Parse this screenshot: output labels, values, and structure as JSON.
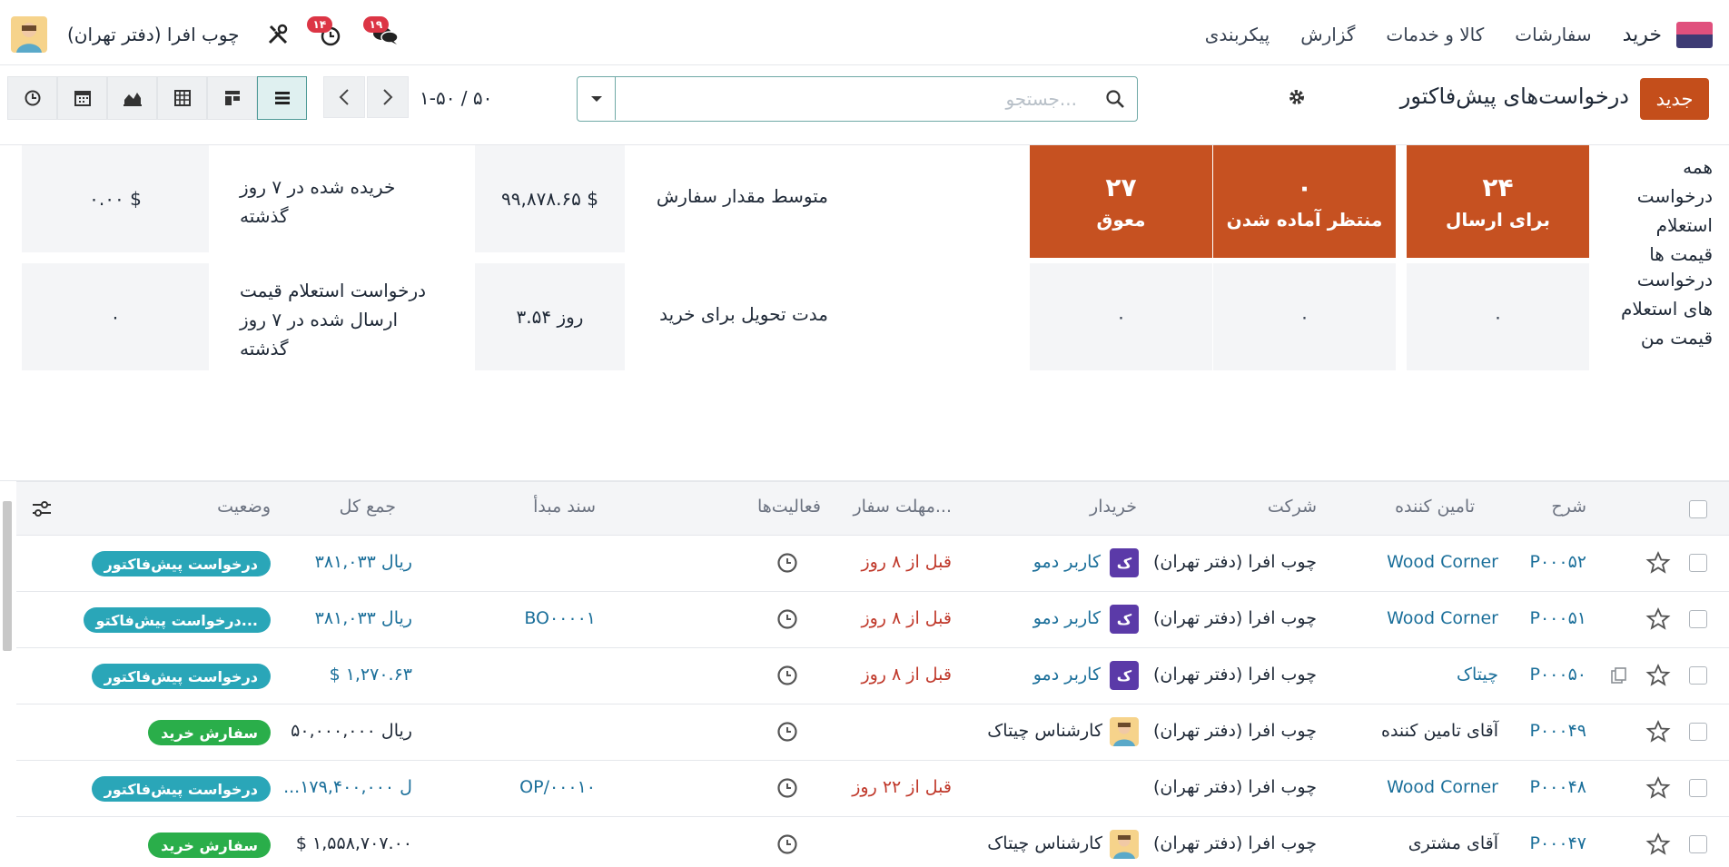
{
  "navbar": {
    "app_name": "خرید",
    "menu": [
      "سفارشات",
      "کالا و خدمات",
      "گزارش",
      "پیکربندی"
    ],
    "messages_count": "۱۹",
    "activities_count": "۱۴",
    "company": "چوب افرا (دفتر تهران)",
    "icons": [
      "app-logo-icon",
      "chat-icon",
      "clock-icon",
      "tools-icon",
      "avatar"
    ]
  },
  "control_panel": {
    "new_label": "جدید",
    "title": "درخواست‌های پیش‌فاکتور",
    "search_placeholder": "جستجو...",
    "pager": "۱-۵۰ / ۵۰",
    "views": [
      "list",
      "kanban",
      "pivot",
      "graph",
      "calendar",
      "activity"
    ],
    "active_view": "list"
  },
  "dashboard": {
    "row1_label": "همه درخواست استعلام قیمت ها",
    "row2_label": "درخواست های استعلام قیمت من",
    "tiles_row1": [
      {
        "num": "۲۴",
        "label": "برای ارسال"
      },
      {
        "num": "۰",
        "label": "منتظر آماده شدن"
      },
      {
        "num": "۲۷",
        "label": "معوق"
      }
    ],
    "tiles_row2": [
      "۰",
      "۰",
      "۰"
    ],
    "kpis": [
      {
        "label": "متوسط مقدار سفارش",
        "value": "۹۹,۸۷۸.۶۵ $"
      },
      {
        "label": "خریده شده در ۷ روز گذشته",
        "value": "۰.۰۰ $"
      },
      {
        "label": "مدت تحویل برای خرید",
        "value": "۳.۵۴ روز"
      },
      {
        "label": "درخواست استعلام قیمت ارسال شده در ۷ روز گذشته",
        "value": "۰"
      }
    ]
  },
  "table": {
    "headers": {
      "ref": "شرح",
      "vendor": "تامین کننده",
      "company": "شرکت",
      "buyer": "خریدار",
      "deadline": "مهلت سفار...",
      "activities": "فعالیت‌ها",
      "origin": "سند مبدأ",
      "total": "جمع کل",
      "status": "وضعیت"
    },
    "rows": [
      {
        "ref": "P۰۰۰۵۲",
        "vendor": "Wood Corner",
        "vendor_link": true,
        "attach": false,
        "company": "چوب افرا (دفتر تهران)",
        "buyer": "کاربر دمو",
        "buyer_avatar": "ک",
        "buyer_kind": "letter",
        "deadline": "قبل از ۸ روز",
        "origin": "",
        "total": "ریال ۳۸۱,۰۳۳",
        "status": "درخواست پیش‌فاکتور",
        "status_kind": "rfq"
      },
      {
        "ref": "P۰۰۰۵۱",
        "vendor": "Wood Corner",
        "vendor_link": true,
        "attach": false,
        "company": "چوب افرا (دفتر تهران)",
        "buyer": "کاربر دمو",
        "buyer_avatar": "ک",
        "buyer_kind": "letter",
        "deadline": "قبل از ۸ روز",
        "origin": "BO۰۰۰۰۱",
        "total": "ریال ۳۸۱,۰۳۳",
        "status": "درخواست پیش‌فاکتو...",
        "status_kind": "rfq"
      },
      {
        "ref": "P۰۰۰۵۰",
        "vendor": "چیتاک",
        "vendor_link": true,
        "attach": true,
        "company": "چوب افرا (دفتر تهران)",
        "buyer": "کاربر دمو",
        "buyer_avatar": "ک",
        "buyer_kind": "letter",
        "deadline": "قبل از ۸ روز",
        "origin": "",
        "total": "$ ۱,۲۷۰.۶۳",
        "status": "درخواست پیش‌فاکتور",
        "status_kind": "rfq"
      },
      {
        "ref": "P۰۰۰۴۹",
        "vendor": "آقای تامین کننده",
        "vendor_link": false,
        "attach": false,
        "company": "چوب افرا (دفتر تهران)",
        "buyer": "کارشناس چیتاک",
        "buyer_avatar": "",
        "buyer_kind": "pic",
        "deadline": "",
        "origin": "",
        "total": "ریال ۵۰,۰۰۰,۰۰۰",
        "status": "سفارش خرید",
        "status_kind": "po"
      },
      {
        "ref": "P۰۰۰۴۸",
        "vendor": "Wood Corner",
        "vendor_link": true,
        "attach": false,
        "company": "چوب افرا (دفتر تهران)",
        "buyer": "",
        "buyer_avatar": "",
        "buyer_kind": "none",
        "deadline": "قبل از ۲۲ روز",
        "origin": "OP/۰۰۰۱۰",
        "total": "...ل ۱۷۹,۴۰۰,۰۰۰",
        "status": "درخواست پیش‌فاکتور",
        "status_kind": "rfq"
      },
      {
        "ref": "P۰۰۰۴۷",
        "vendor": "آقای مشتری",
        "vendor_link": false,
        "attach": false,
        "company": "چوب افرا (دفتر تهران)",
        "buyer": "کارشناس چیتاک",
        "buyer_avatar": "",
        "buyer_kind": "pic",
        "deadline": "",
        "origin": "",
        "total": "$ ۱,۵۵۸,۷۰۷.۰۰",
        "status": "سفارش خرید",
        "status_kind": "po"
      }
    ]
  },
  "colors": {
    "primary": "#c44e1b",
    "tile_orange": "#c65121",
    "link": "#1b6f9a",
    "deadline": "#c0392b",
    "rfq_badge": "#2aa6b8",
    "po_badge": "#2aae4a",
    "buyer_avatar": "#5b3aa8"
  }
}
